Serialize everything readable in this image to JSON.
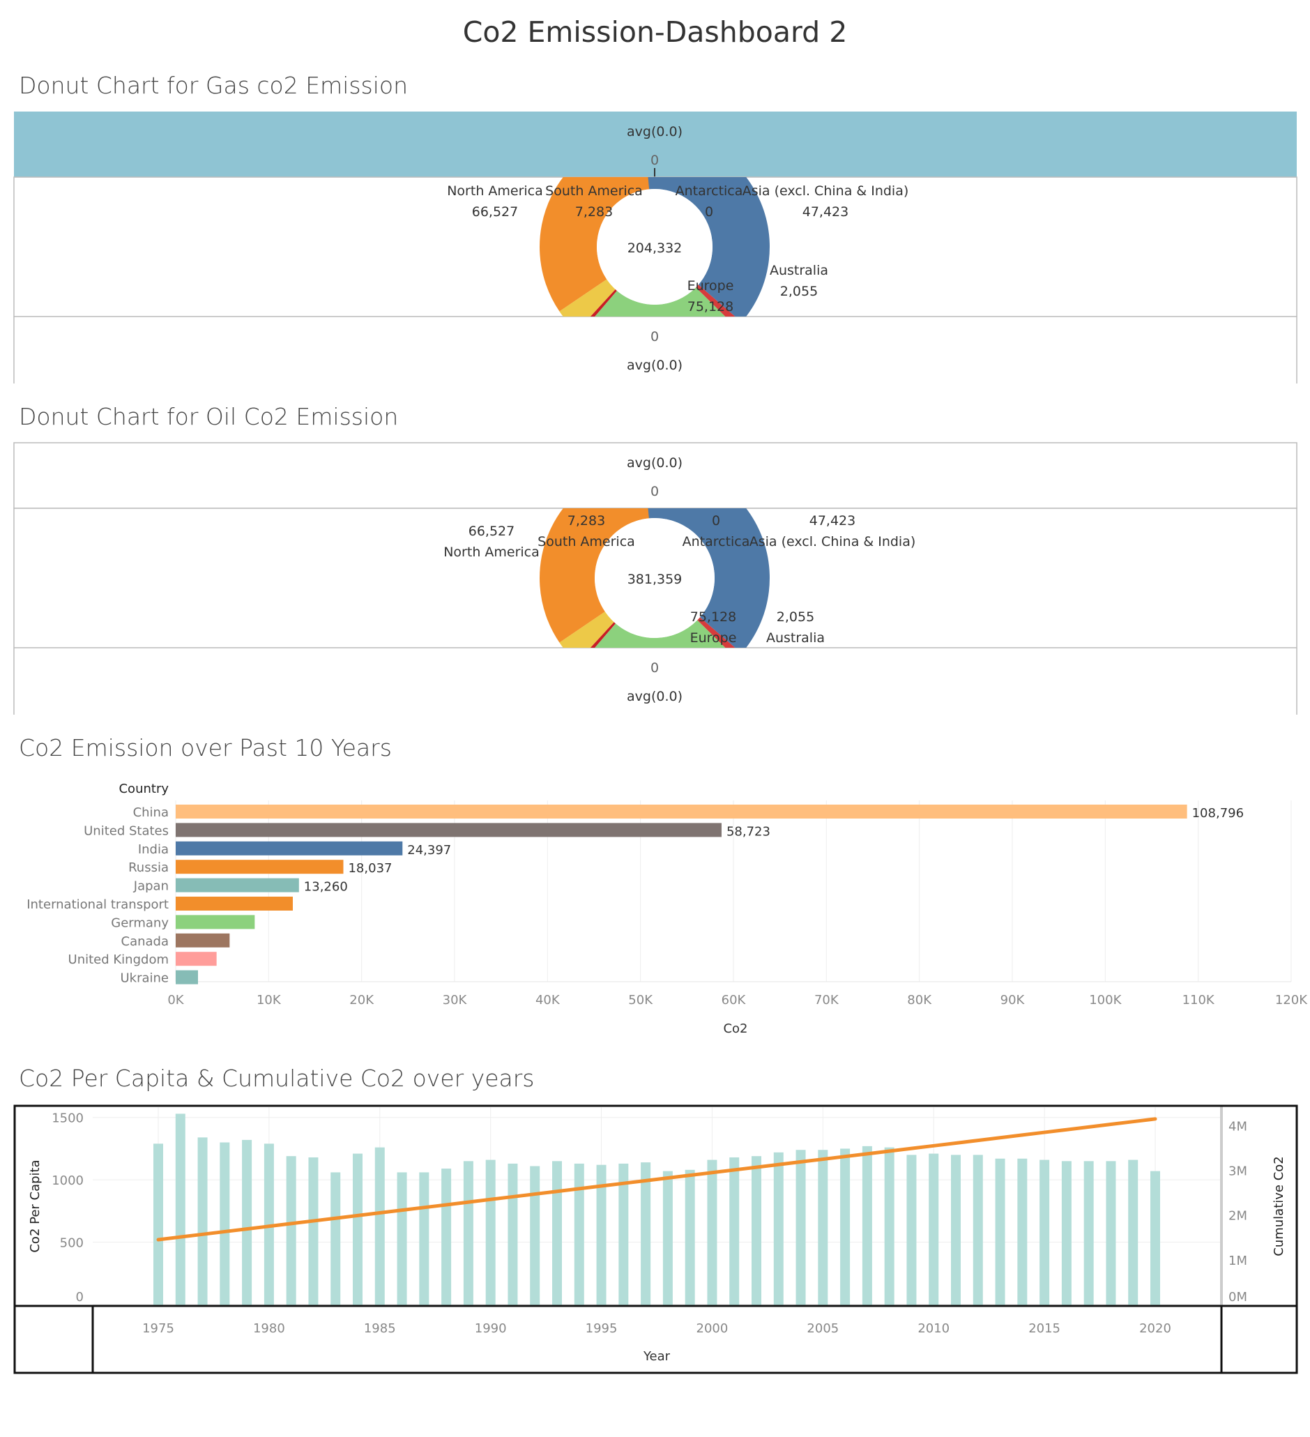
{
  "dashboard_title": "Co2 Emission-Dashboard 2",
  "colors": {
    "header_band": "#8fc4d3",
    "north_america": "#f28e2b",
    "south_america": "#edc948",
    "antarctica": "#c81d25",
    "asia": "#8cd17d",
    "australia": "#d63c3c",
    "europe": "#4e79a7",
    "per_capita_bar": "#b3ddd8",
    "cumulative_line": "#f28e2b"
  },
  "gas_chart": {
    "title": "Donut Chart for Gas co2 Emission",
    "top_label": "avg(0.0)",
    "top_value": "0",
    "bottom_value": "0",
    "bottom_label": "avg(0.0)",
    "center_total": "204,332"
  },
  "oil_chart": {
    "title": "Donut Chart for Oil Co2 Emission",
    "top_label": "avg(0.0)",
    "top_value": "0",
    "bottom_value": "0",
    "bottom_label": "avg(0.0)",
    "center_total": "381,359"
  },
  "bar_chart": {
    "title": "Co2 Emission over Past 10 Years",
    "axis_header": "Country",
    "xlabel": "Co2"
  },
  "combo_chart": {
    "title": "Co2 Per Capita & Cumulative Co2 over years",
    "left_axis_label": "Co2 Per Capita",
    "right_axis_label": "Cumulative Co2",
    "xlabel": "Year"
  },
  "chart_data": [
    {
      "type": "pie",
      "title": "Donut Chart for Gas co2 Emission",
      "center_label": "204,332",
      "slices": [
        {
          "name": "North America",
          "value": 66527,
          "label": "66,527"
        },
        {
          "name": "South America",
          "value": 7283,
          "label": "7,283"
        },
        {
          "name": "Antarctica",
          "value": 0,
          "label": "0"
        },
        {
          "name": "Asia (excl. China & India)",
          "value": 47423,
          "label": "47,423"
        },
        {
          "name": "Australia",
          "value": 2055,
          "label": "2,055"
        },
        {
          "name": "Europe",
          "value": 75128,
          "label": "75,128"
        }
      ]
    },
    {
      "type": "pie",
      "title": "Donut Chart for Oil Co2 Emission",
      "center_label": "381,359",
      "slices": [
        {
          "name": "North America",
          "value": 66527,
          "label": "66,527"
        },
        {
          "name": "South America",
          "value": 7283,
          "label": "7,283"
        },
        {
          "name": "Antarctica",
          "value": 0,
          "label": "0"
        },
        {
          "name": "Asia (excl. China & India)",
          "value": 47423,
          "label": "47,423"
        },
        {
          "name": "Australia",
          "value": 2055,
          "label": "2,055"
        },
        {
          "name": "Europe",
          "value": 75128,
          "label": "75,128"
        }
      ]
    },
    {
      "type": "bar",
      "orientation": "horizontal",
      "title": "Co2 Emission over Past 10 Years",
      "categories": [
        "China",
        "United States",
        "India",
        "Russia",
        "Japan",
        "International transport",
        "Germany",
        "Canada",
        "United Kingdom",
        "Ukraine"
      ],
      "values": [
        108796,
        58723,
        24397,
        18037,
        13260,
        12600,
        8500,
        5800,
        4400,
        2400
      ],
      "value_labels": [
        "108,796",
        "58,723",
        "24,397",
        "18,037",
        "13,260",
        "",
        "",
        "",
        "",
        ""
      ],
      "bar_colors": [
        "#ffbe7d",
        "#7f7471",
        "#4e79a7",
        "#f28e2b",
        "#86bcb6",
        "#f28e2b",
        "#8cd17d",
        "#9d7660",
        "#ff9d9a",
        "#86bcb6"
      ],
      "xticks": [
        "0K",
        "10K",
        "20K",
        "30K",
        "40K",
        "50K",
        "60K",
        "70K",
        "80K",
        "90K",
        "100K",
        "110K",
        "120K"
      ],
      "xlim": [
        0,
        120000
      ],
      "xlabel": "Co2",
      "ylabel": "Country"
    },
    {
      "type": "bar",
      "title": "Co2 Per Capita & Cumulative Co2 over years",
      "x": [
        1975,
        1976,
        1977,
        1978,
        1979,
        1980,
        1981,
        1982,
        1983,
        1984,
        1985,
        1986,
        1987,
        1988,
        1989,
        1990,
        1991,
        1992,
        1993,
        1994,
        1995,
        1996,
        1997,
        1998,
        1999,
        2000,
        2001,
        2002,
        2003,
        2004,
        2005,
        2006,
        2007,
        2008,
        2009,
        2010,
        2011,
        2012,
        2013,
        2014,
        2015,
        2016,
        2017,
        2018,
        2019,
        2020
      ],
      "series": [
        {
          "name": "Co2 Per Capita",
          "type": "bar",
          "axis": "left",
          "values": [
            1290,
            1530,
            1340,
            1300,
            1320,
            1290,
            1190,
            1180,
            1060,
            1210,
            1260,
            1060,
            1060,
            1090,
            1150,
            1160,
            1130,
            1110,
            1150,
            1130,
            1120,
            1130,
            1140,
            1070,
            1080,
            1160,
            1180,
            1190,
            1220,
            1240,
            1240,
            1250,
            1270,
            1260,
            1200,
            1210,
            1200,
            1200,
            1170,
            1170,
            1160,
            1150,
            1150,
            1150,
            1160,
            1070
          ]
        },
        {
          "name": "Cumulative Co2",
          "type": "line",
          "axis": "right",
          "values": [
            1450000,
            1510000,
            1570000,
            1630000,
            1690000,
            1750000,
            1810000,
            1870000,
            1930000,
            1990000,
            2050000,
            2110000,
            2170000,
            2230000,
            2290000,
            2350000,
            2410000,
            2470000,
            2530000,
            2590000,
            2650000,
            2710000,
            2770000,
            2830000,
            2890000,
            2950000,
            3010000,
            3070000,
            3130000,
            3190000,
            3250000,
            3310000,
            3370000,
            3430000,
            3490000,
            3550000,
            3610000,
            3670000,
            3730000,
            3790000,
            3850000,
            3910000,
            3970000,
            4030000,
            4090000,
            4150000
          ]
        }
      ],
      "left_yticks": [
        "0",
        "500",
        "1000",
        "1500"
      ],
      "left_ylim": [
        0,
        1560
      ],
      "right_yticks": [
        "0M",
        "1M",
        "2M",
        "3M",
        "4M"
      ],
      "right_ylim": [
        0,
        4350000
      ],
      "xticks": [
        "1975",
        "1980",
        "1985",
        "1990",
        "1995",
        "2000",
        "2005",
        "2010",
        "2015",
        "2020"
      ],
      "xlabel": "Year",
      "ylabel": "Co2 Per Capita",
      "y2label": "Cumulative Co2"
    }
  ]
}
